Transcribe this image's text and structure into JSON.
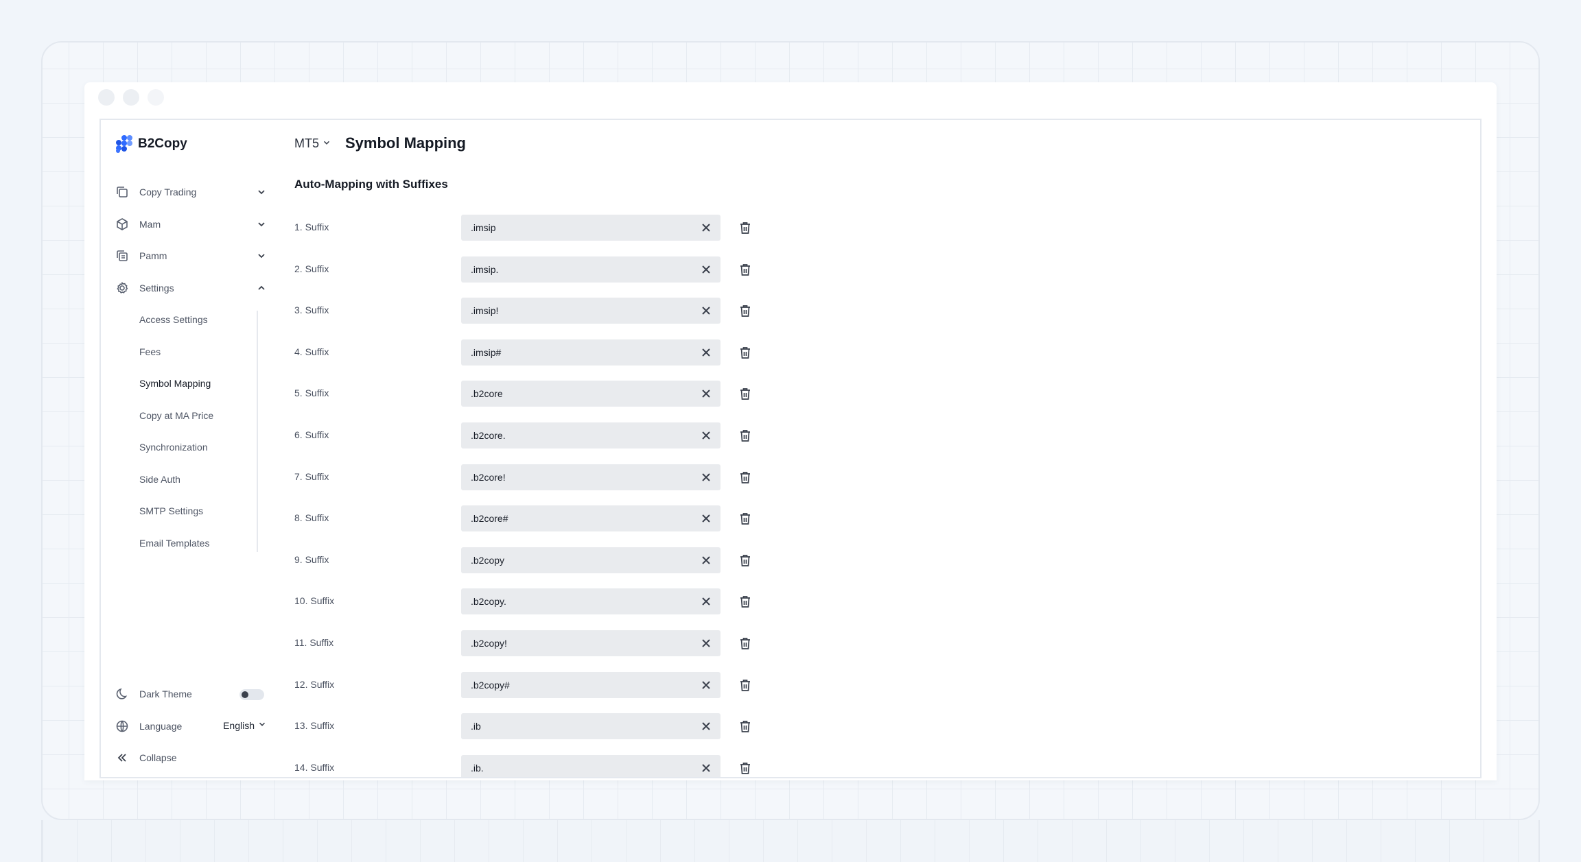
{
  "app": {
    "name": "B2Copy"
  },
  "sidebar": {
    "items": [
      {
        "label": "Copy Trading",
        "icon": "copy-icon",
        "expanded": false
      },
      {
        "label": "Mam",
        "icon": "cube-icon",
        "expanded": false
      },
      {
        "label": "Pamm",
        "icon": "duplicate-icon",
        "expanded": false
      },
      {
        "label": "Settings",
        "icon": "gear-icon",
        "expanded": true
      }
    ],
    "settings_subitems": [
      {
        "label": "Access Settings",
        "active": false
      },
      {
        "label": "Fees",
        "active": false
      },
      {
        "label": "Symbol Mapping",
        "active": true
      },
      {
        "label": "Copy at MA Price",
        "active": false
      },
      {
        "label": "Synchronization",
        "active": false
      },
      {
        "label": "Side Auth",
        "active": false
      },
      {
        "label": "SMTP Settings",
        "active": false
      },
      {
        "label": "Email Templates",
        "active": false
      }
    ],
    "dark_theme": {
      "label": "Dark Theme",
      "enabled": false
    },
    "language": {
      "label": "Language",
      "value": "English"
    },
    "collapse": {
      "label": "Collapse"
    }
  },
  "header": {
    "platform": "MT5",
    "title": "Symbol Mapping"
  },
  "section": {
    "title": "Auto-Mapping with Suffixes"
  },
  "suffixes": [
    {
      "label": "1. Suffix",
      "value": ".imsip"
    },
    {
      "label": "2. Suffix",
      "value": ".imsip."
    },
    {
      "label": "3. Suffix",
      "value": ".imsip!"
    },
    {
      "label": "4. Suffix",
      "value": ".imsip#"
    },
    {
      "label": "5. Suffix",
      "value": ".b2core"
    },
    {
      "label": "6. Suffix",
      "value": ".b2core."
    },
    {
      "label": "7. Suffix",
      "value": ".b2core!"
    },
    {
      "label": "8. Suffix",
      "value": ".b2core#"
    },
    {
      "label": "9. Suffix",
      "value": ".b2copy"
    },
    {
      "label": "10. Suffix",
      "value": ".b2copy."
    },
    {
      "label": "11. Suffix",
      "value": ".b2copy!"
    },
    {
      "label": "12. Suffix",
      "value": ".b2copy#"
    },
    {
      "label": "13. Suffix",
      "value": ".ib"
    },
    {
      "label": "14. Suffix",
      "value": ".ib."
    }
  ],
  "colors": {
    "accent": "#2f6bff",
    "input_bg": "#e9ebee",
    "page_bg": "#f1f5fa"
  }
}
